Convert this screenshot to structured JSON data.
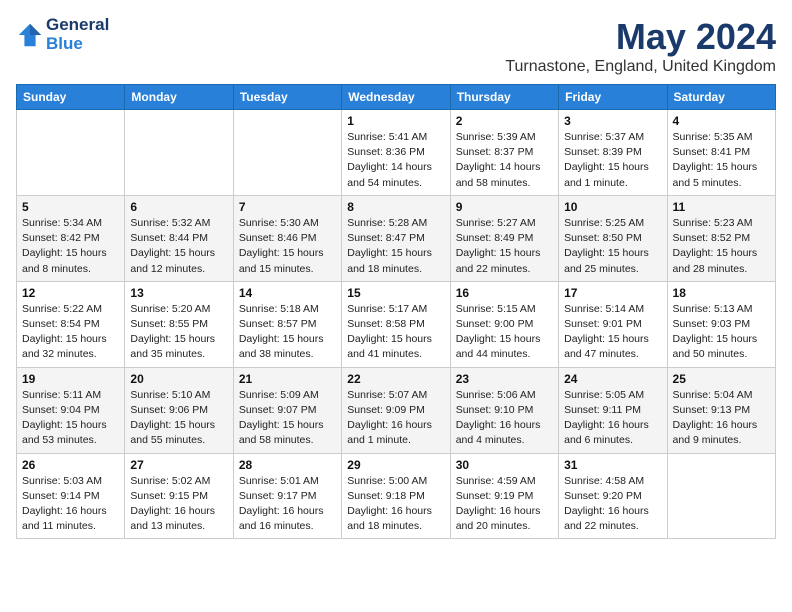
{
  "header": {
    "logo_line1": "General",
    "logo_line2": "Blue",
    "month": "May 2024",
    "location": "Turnastone, England, United Kingdom"
  },
  "days_of_week": [
    "Sunday",
    "Monday",
    "Tuesday",
    "Wednesday",
    "Thursday",
    "Friday",
    "Saturday"
  ],
  "weeks": [
    [
      {
        "num": "",
        "info": ""
      },
      {
        "num": "",
        "info": ""
      },
      {
        "num": "",
        "info": ""
      },
      {
        "num": "1",
        "info": "Sunrise: 5:41 AM\nSunset: 8:36 PM\nDaylight: 14 hours\nand 54 minutes."
      },
      {
        "num": "2",
        "info": "Sunrise: 5:39 AM\nSunset: 8:37 PM\nDaylight: 14 hours\nand 58 minutes."
      },
      {
        "num": "3",
        "info": "Sunrise: 5:37 AM\nSunset: 8:39 PM\nDaylight: 15 hours\nand 1 minute."
      },
      {
        "num": "4",
        "info": "Sunrise: 5:35 AM\nSunset: 8:41 PM\nDaylight: 15 hours\nand 5 minutes."
      }
    ],
    [
      {
        "num": "5",
        "info": "Sunrise: 5:34 AM\nSunset: 8:42 PM\nDaylight: 15 hours\nand 8 minutes."
      },
      {
        "num": "6",
        "info": "Sunrise: 5:32 AM\nSunset: 8:44 PM\nDaylight: 15 hours\nand 12 minutes."
      },
      {
        "num": "7",
        "info": "Sunrise: 5:30 AM\nSunset: 8:46 PM\nDaylight: 15 hours\nand 15 minutes."
      },
      {
        "num": "8",
        "info": "Sunrise: 5:28 AM\nSunset: 8:47 PM\nDaylight: 15 hours\nand 18 minutes."
      },
      {
        "num": "9",
        "info": "Sunrise: 5:27 AM\nSunset: 8:49 PM\nDaylight: 15 hours\nand 22 minutes."
      },
      {
        "num": "10",
        "info": "Sunrise: 5:25 AM\nSunset: 8:50 PM\nDaylight: 15 hours\nand 25 minutes."
      },
      {
        "num": "11",
        "info": "Sunrise: 5:23 AM\nSunset: 8:52 PM\nDaylight: 15 hours\nand 28 minutes."
      }
    ],
    [
      {
        "num": "12",
        "info": "Sunrise: 5:22 AM\nSunset: 8:54 PM\nDaylight: 15 hours\nand 32 minutes."
      },
      {
        "num": "13",
        "info": "Sunrise: 5:20 AM\nSunset: 8:55 PM\nDaylight: 15 hours\nand 35 minutes."
      },
      {
        "num": "14",
        "info": "Sunrise: 5:18 AM\nSunset: 8:57 PM\nDaylight: 15 hours\nand 38 minutes."
      },
      {
        "num": "15",
        "info": "Sunrise: 5:17 AM\nSunset: 8:58 PM\nDaylight: 15 hours\nand 41 minutes."
      },
      {
        "num": "16",
        "info": "Sunrise: 5:15 AM\nSunset: 9:00 PM\nDaylight: 15 hours\nand 44 minutes."
      },
      {
        "num": "17",
        "info": "Sunrise: 5:14 AM\nSunset: 9:01 PM\nDaylight: 15 hours\nand 47 minutes."
      },
      {
        "num": "18",
        "info": "Sunrise: 5:13 AM\nSunset: 9:03 PM\nDaylight: 15 hours\nand 50 minutes."
      }
    ],
    [
      {
        "num": "19",
        "info": "Sunrise: 5:11 AM\nSunset: 9:04 PM\nDaylight: 15 hours\nand 53 minutes."
      },
      {
        "num": "20",
        "info": "Sunrise: 5:10 AM\nSunset: 9:06 PM\nDaylight: 15 hours\nand 55 minutes."
      },
      {
        "num": "21",
        "info": "Sunrise: 5:09 AM\nSunset: 9:07 PM\nDaylight: 15 hours\nand 58 minutes."
      },
      {
        "num": "22",
        "info": "Sunrise: 5:07 AM\nSunset: 9:09 PM\nDaylight: 16 hours\nand 1 minute."
      },
      {
        "num": "23",
        "info": "Sunrise: 5:06 AM\nSunset: 9:10 PM\nDaylight: 16 hours\nand 4 minutes."
      },
      {
        "num": "24",
        "info": "Sunrise: 5:05 AM\nSunset: 9:11 PM\nDaylight: 16 hours\nand 6 minutes."
      },
      {
        "num": "25",
        "info": "Sunrise: 5:04 AM\nSunset: 9:13 PM\nDaylight: 16 hours\nand 9 minutes."
      }
    ],
    [
      {
        "num": "26",
        "info": "Sunrise: 5:03 AM\nSunset: 9:14 PM\nDaylight: 16 hours\nand 11 minutes."
      },
      {
        "num": "27",
        "info": "Sunrise: 5:02 AM\nSunset: 9:15 PM\nDaylight: 16 hours\nand 13 minutes."
      },
      {
        "num": "28",
        "info": "Sunrise: 5:01 AM\nSunset: 9:17 PM\nDaylight: 16 hours\nand 16 minutes."
      },
      {
        "num": "29",
        "info": "Sunrise: 5:00 AM\nSunset: 9:18 PM\nDaylight: 16 hours\nand 18 minutes."
      },
      {
        "num": "30",
        "info": "Sunrise: 4:59 AM\nSunset: 9:19 PM\nDaylight: 16 hours\nand 20 minutes."
      },
      {
        "num": "31",
        "info": "Sunrise: 4:58 AM\nSunset: 9:20 PM\nDaylight: 16 hours\nand 22 minutes."
      },
      {
        "num": "",
        "info": ""
      }
    ]
  ]
}
